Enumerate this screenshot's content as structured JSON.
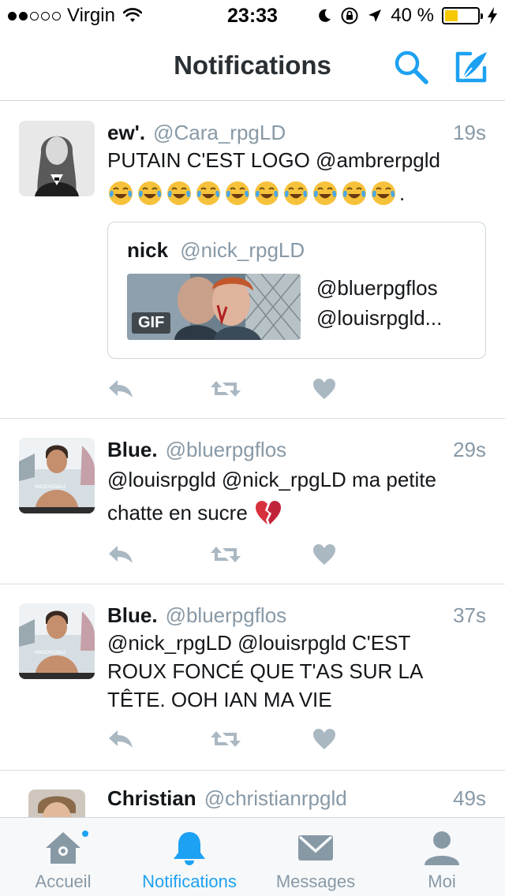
{
  "status_bar": {
    "carrier": "Virgin",
    "time": "23:33",
    "battery": "40 %",
    "battery_level": 0.4
  },
  "nav": {
    "title": "Notifications",
    "search_icon": "search-icon",
    "compose_icon": "compose-icon"
  },
  "tweets": [
    {
      "name": "ew'.",
      "handle": "@Cara_rpgLD",
      "time": "19s",
      "text": "PUTAIN C'EST LOGO @ambrerpgld",
      "trailing": ".",
      "emoji_count": 10,
      "quote": {
        "name": "nick",
        "handle": "@nick_rpgLD",
        "media_badge": "GIF",
        "text_line1": "@bluerpgflos",
        "text_line2": "@louisrpgld..."
      }
    },
    {
      "name": "Blue.",
      "handle": "@bluerpgflos",
      "time": "29s",
      "text_line1": "@louisrpgld @nick_rpgLD ma petite",
      "text_line2": "chatte en sucre"
    },
    {
      "name": "Blue.",
      "handle": "@bluerpgflos",
      "time": "37s",
      "text_line1": "@nick_rpgLD @louisrpgld C'EST",
      "text_line2": "ROUX FONCÉ QUE T'AS SUR LA",
      "text_line3": "TÊTE. OOH IAN MA VIE"
    },
    {
      "name": "Christian",
      "handle": "@christianrpgld",
      "time": "49s"
    }
  ],
  "tabs": [
    {
      "label": "Accueil",
      "icon": "home-icon"
    },
    {
      "label": "Notifications",
      "icon": "bell-icon"
    },
    {
      "label": "Messages",
      "icon": "envelope-icon"
    },
    {
      "label": "Moi",
      "icon": "person-icon"
    }
  ],
  "colors": {
    "accent": "#1da1f2",
    "muted": "#8899a6",
    "action_icon": "#aab8c2"
  }
}
